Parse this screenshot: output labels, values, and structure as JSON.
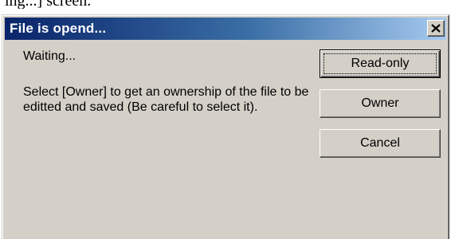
{
  "page_fragment": "ing...] screen.",
  "dialog": {
    "title": "File is opend...",
    "close_glyph": "✕",
    "waiting_text": "Waiting...",
    "message": "Select [Owner] to get an ownership of the file to be editted and saved (Be careful to select it).",
    "buttons": {
      "readonly": "Read-only",
      "owner": "Owner",
      "cancel": "Cancel"
    },
    "default_button": "readonly"
  },
  "colors": {
    "title_start": "#0a246a",
    "title_end": "#a6caf0",
    "face": "#d4d0c8"
  },
  "icons": {
    "close": "close-icon"
  }
}
